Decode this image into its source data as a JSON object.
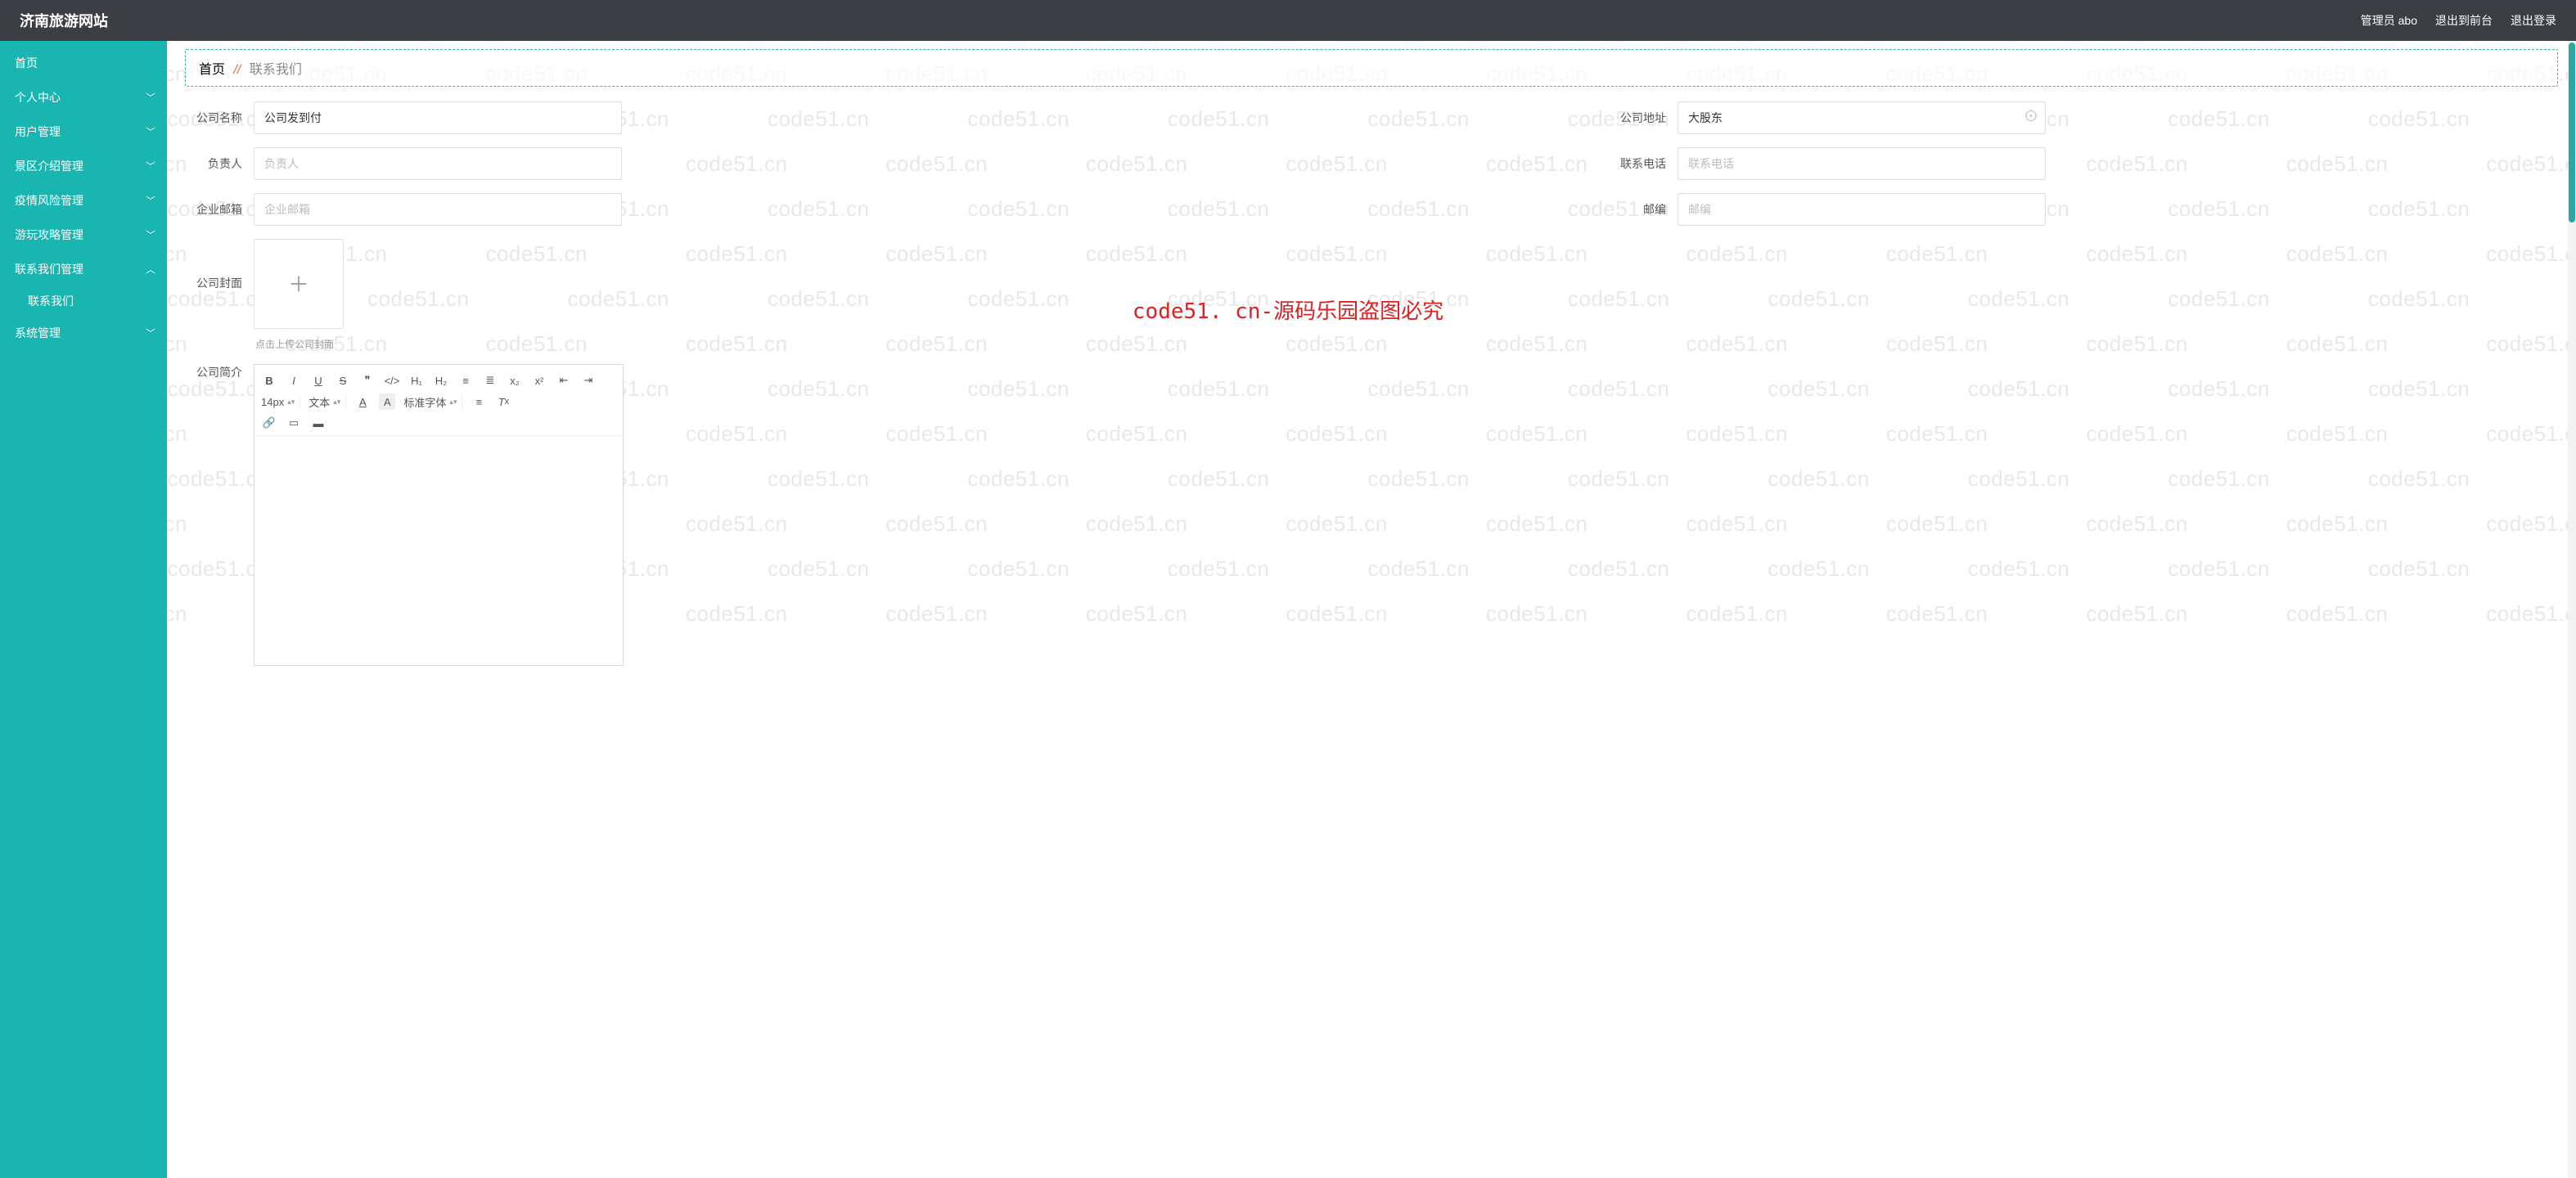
{
  "header": {
    "brand": "济南旅游网站",
    "admin_label": "管理员 abo",
    "back_front_label": "退出到前台",
    "logout_label": "退出登录"
  },
  "sidebar": {
    "items": [
      {
        "label": "首页",
        "expandable": false
      },
      {
        "label": "个人中心",
        "expandable": true,
        "open": false
      },
      {
        "label": "用户管理",
        "expandable": true,
        "open": false
      },
      {
        "label": "景区介绍管理",
        "expandable": true,
        "open": false
      },
      {
        "label": "疫情风险管理",
        "expandable": true,
        "open": false
      },
      {
        "label": "游玩攻略管理",
        "expandable": true,
        "open": false
      },
      {
        "label": "联系我们管理",
        "expandable": true,
        "open": true,
        "children": [
          {
            "label": "联系我们"
          }
        ]
      },
      {
        "label": "系统管理",
        "expandable": true,
        "open": false
      }
    ]
  },
  "breadcrumb": {
    "root": "首页",
    "sep": "//",
    "current": "联系我们"
  },
  "form": {
    "company_name": {
      "label": "公司名称",
      "value": "公司发到付",
      "placeholder": "公司名称"
    },
    "company_addr": {
      "label": "公司地址",
      "value": "大股东",
      "placeholder": "公司地址"
    },
    "responsible": {
      "label": "负责人",
      "value": "",
      "placeholder": "负责人"
    },
    "phone": {
      "label": "联系电话",
      "value": "",
      "placeholder": "联系电话"
    },
    "email": {
      "label": "企业邮箱",
      "value": "",
      "placeholder": "企业邮箱"
    },
    "postcode": {
      "label": "邮编",
      "value": "",
      "placeholder": "邮编"
    },
    "cover": {
      "label": "公司封面",
      "hint": "点击上传公司封面"
    },
    "intro": {
      "label": "公司简介"
    }
  },
  "editor_toolbar": {
    "font_size": "14px",
    "block_label": "文本",
    "font_family_label": "标准字体"
  },
  "watermark": {
    "repeat_text": "code51.cn",
    "center_text": "code51. cn-源码乐园盗图必究"
  }
}
